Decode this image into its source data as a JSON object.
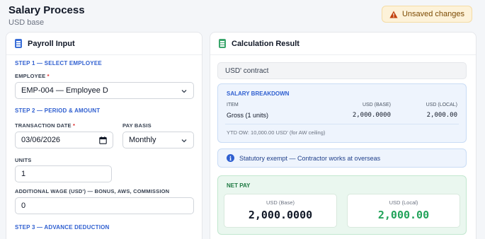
{
  "header": {
    "title": "Salary Process",
    "subtitle": "USD base",
    "unsaved_label": "Unsaved changes"
  },
  "left_panel": {
    "title": "Payroll Input",
    "step1": {
      "title": "STEP 1 — SELECT EMPLOYEE",
      "employee_label": "EMPLOYEE",
      "employee_value": "EMP-004 — Employee D"
    },
    "step2": {
      "title": "STEP 2 — PERIOD & AMOUNT",
      "date_label": "TRANSACTION DATE",
      "date_value": "03/06/2026",
      "basis_label": "PAY BASIS",
      "basis_value": "Monthly",
      "units_label": "UNITS",
      "units_value": "1",
      "additional_label": "ADDITIONAL WAGE (USD') — BONUS, AWS, COMMISSION",
      "additional_value": "0"
    },
    "step3": {
      "title": "STEP 3 — ADVANCE DEDUCTION"
    },
    "required_marker": "*"
  },
  "right_panel": {
    "title": "Calculation Result",
    "contract": "USD' contract",
    "breakdown": {
      "title": "SALARY BREAKDOWN",
      "columns": [
        "ITEM",
        "USD (BASE)",
        "USD (LOCAL)"
      ],
      "rows": [
        {
          "item": "Gross (1 units)",
          "base": "2,000.0000",
          "local": "2,000.00"
        }
      ],
      "note": "YTD OW: 10,000.00 USD' (for AW ceiling)"
    },
    "exempt_notice": "Statutory exempt — Contractor works at overseas",
    "net_pay": {
      "title": "NET PAY",
      "base_label": "USD (Base)",
      "base_value": "2,000.0000",
      "local_label": "USD (Local)",
      "local_value": "2,000.00"
    }
  },
  "colors": {
    "accent_blue": "#2f5fd0",
    "accent_green": "#22a35a",
    "warning_bg": "#fdf2d9"
  },
  "icons": {
    "warning": "warning-triangle-icon",
    "payroll": "calculator-icon",
    "result": "spreadsheet-icon",
    "info": "info-circle-icon",
    "dropdown": "chevron-down-icon",
    "calendar": "calendar-icon"
  }
}
